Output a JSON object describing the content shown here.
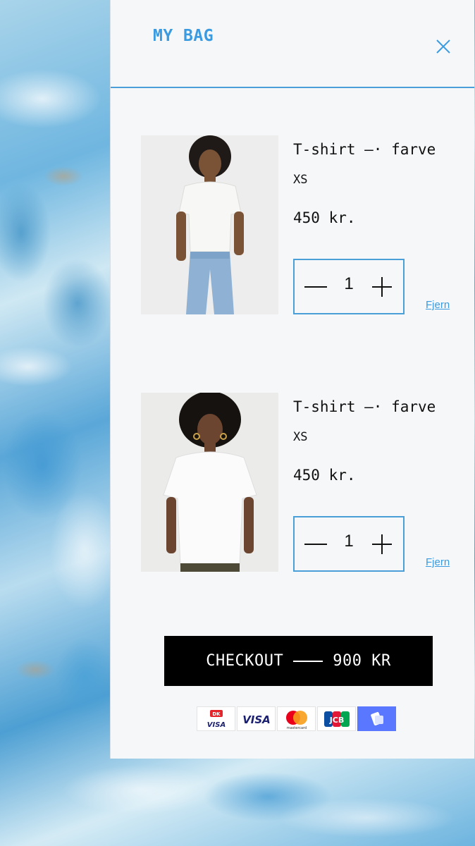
{
  "drawer": {
    "title": "MY BAG",
    "close_icon": "close-icon"
  },
  "items": [
    {
      "name": "T-shirt –· farve",
      "size": "XS",
      "price": "450 kr.",
      "quantity": "1",
      "remove_label": "Fjern"
    },
    {
      "name": "T-shirt –· farve",
      "size": "XS",
      "price": "450 kr.",
      "quantity": "1",
      "remove_label": "Fjern"
    }
  ],
  "checkout": {
    "label": "CHECKOUT",
    "total": "900 KR"
  },
  "payments": {
    "dankort_text": "VISA",
    "visa_text": "VISA",
    "mastercard_text": "mastercard",
    "jcb_text": "JCB"
  },
  "colors": {
    "accent": "#3a9be0",
    "panel": "#f6f7f9",
    "checkout_bg": "#000000"
  }
}
